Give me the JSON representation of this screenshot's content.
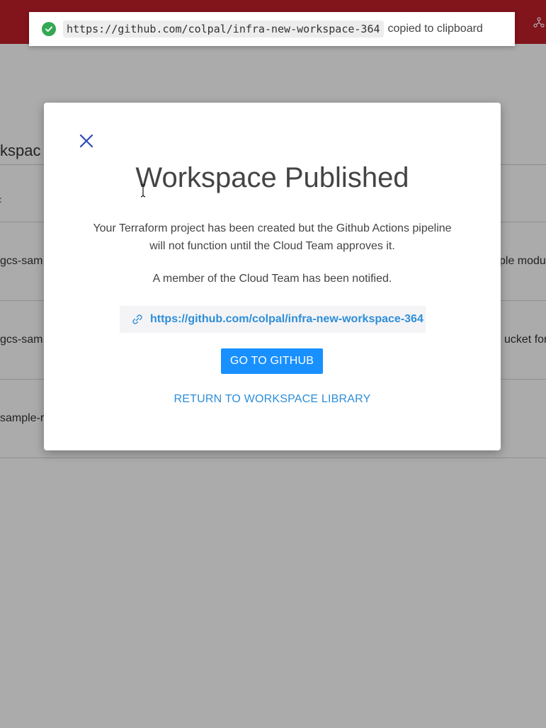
{
  "toast": {
    "url": "https://github.com/colpal/infra-new-workspace-364",
    "message": "copied to clipboard",
    "status_color": "#34a853"
  },
  "background": {
    "heading": "kspac",
    "column_header": "c",
    "rows": [
      {
        "left": "gcs-sam",
        "right": "ple modu"
      },
      {
        "left": "gcs-sam",
        "right": "ucket for"
      },
      {
        "left": "sample-r",
        "right": ""
      }
    ]
  },
  "modal": {
    "title": "Workspace Published",
    "description": "Your Terraform project has been created but the Github Actions pipeline will not function until the Cloud Team approves it.",
    "notice": "A member of the Cloud Team has been notified.",
    "repo_link": "https://github.com/colpal/infra-new-workspace-364",
    "github_button": "GO TO GITHUB",
    "return_link": "RETURN TO WORKSPACE LIBRARY"
  },
  "icons": {
    "success": "check-circle-icon",
    "close": "close-icon",
    "link": "link-icon",
    "header": "nodes-icon",
    "cursor": "text-cursor-icon"
  },
  "colors": {
    "header": "#c21f2a",
    "accent": "#1890ff",
    "link": "#2d8ed9"
  }
}
